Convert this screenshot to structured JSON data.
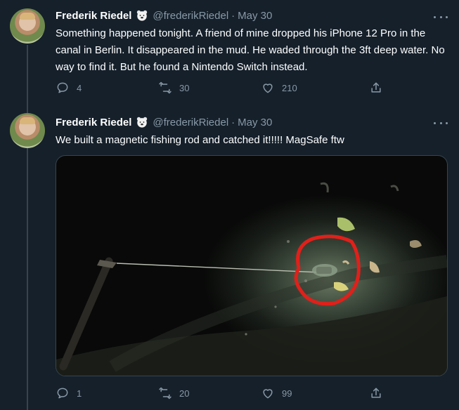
{
  "tweets": [
    {
      "author_name": "Frederik Riedel",
      "author_handle": "@frederikRiedel",
      "separator": "·",
      "date": "May 30",
      "text": "Something happened tonight. A friend of mine dropped his iPhone 12 Pro in the canal in Berlin. It disappeared in the mud. He waded through the 3ft deep water. No way to find it. But he found a Nintendo Switch instead.",
      "replies": "4",
      "retweets": "30",
      "likes": "210"
    },
    {
      "author_name": "Frederik Riedel",
      "author_handle": "@frederikRiedel",
      "separator": "·",
      "date": "May 30",
      "text": "We built a magnetic fishing rod and catched it!!!!! MagSafe ftw",
      "replies": "1",
      "retweets": "20",
      "likes": "99"
    }
  ],
  "icons": {
    "badge": "polar-bear-emoji",
    "more": "more-dots-icon",
    "reply": "reply-icon",
    "retweet": "retweet-icon",
    "like": "like-icon",
    "share": "share-icon"
  },
  "colors": {
    "background": "#15202b",
    "secondary_text": "#8899a6",
    "divider": "#38444d",
    "circle_annotation": "#e0201a"
  }
}
